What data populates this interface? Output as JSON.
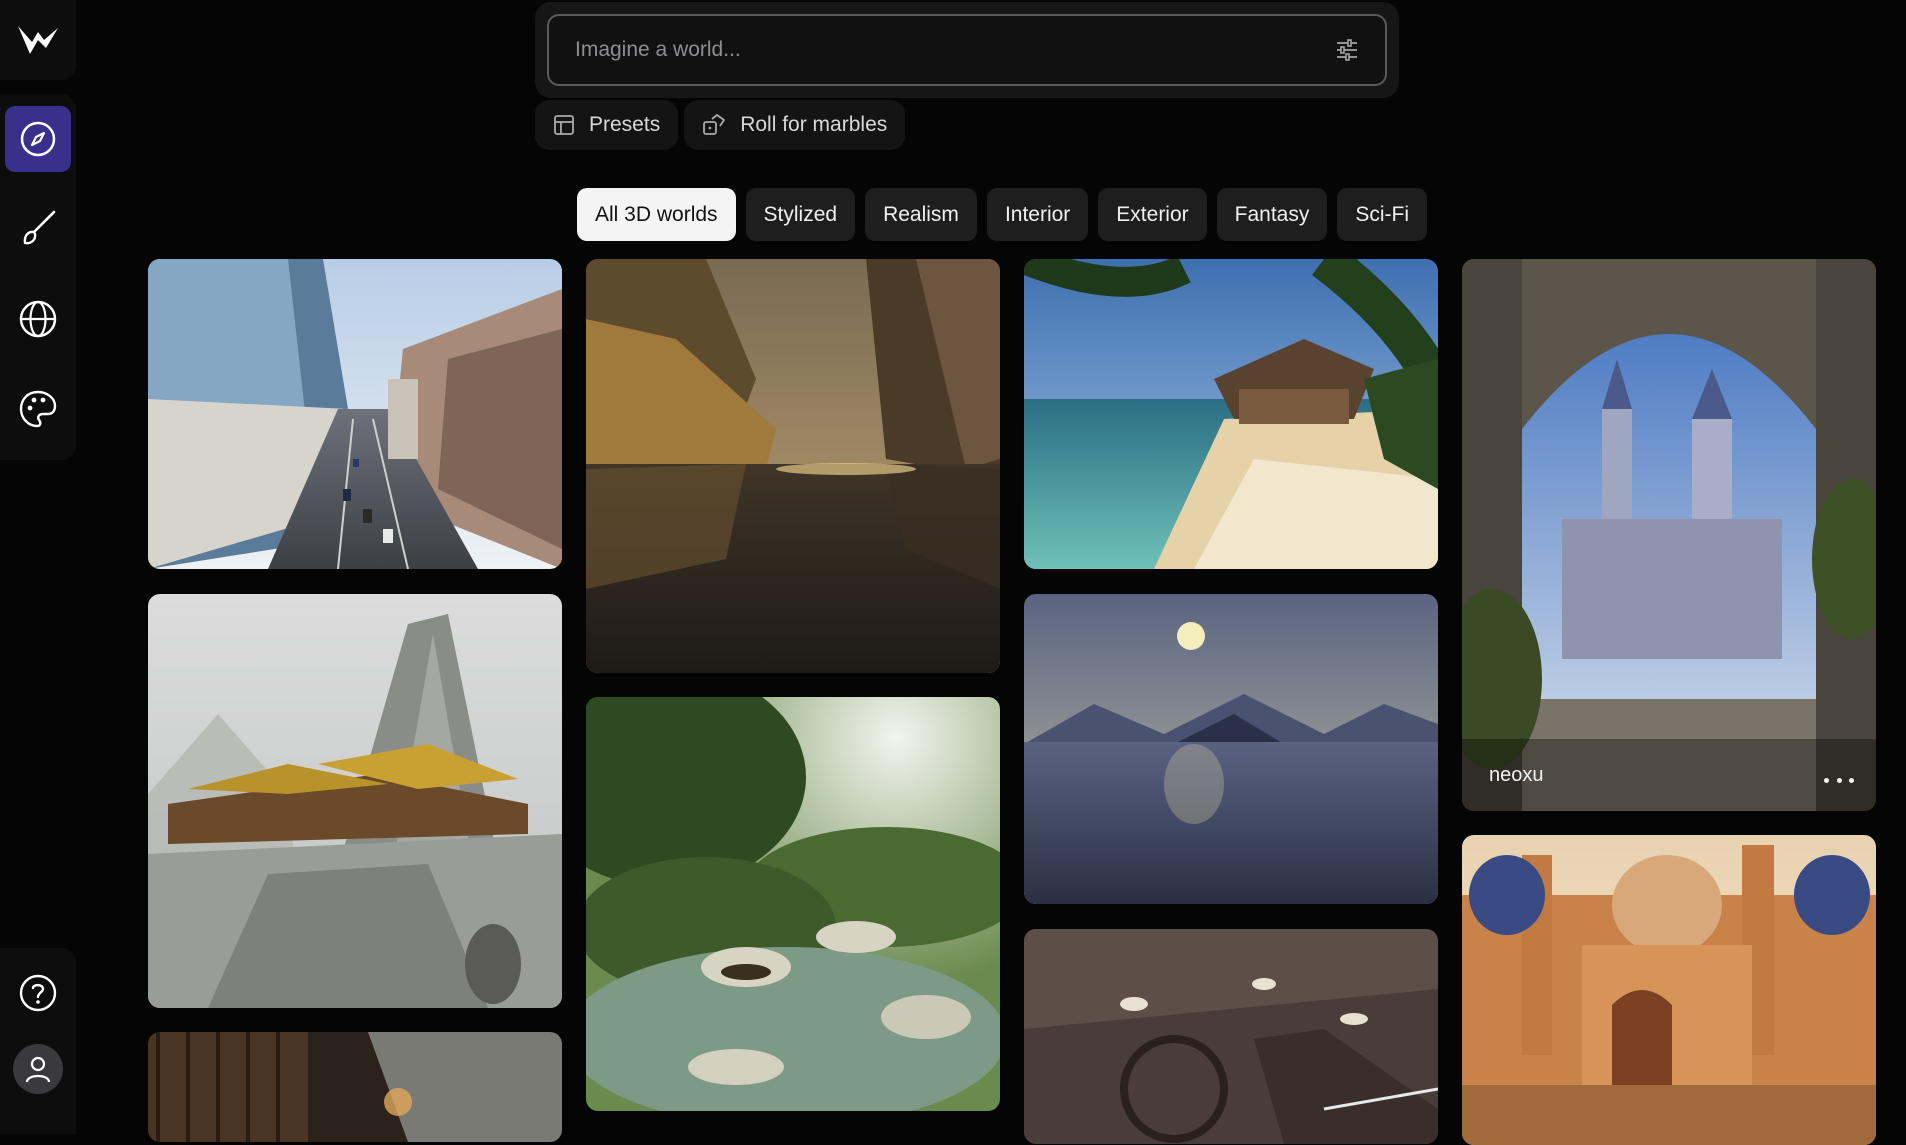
{
  "search": {
    "placeholder": "Imagine a world..."
  },
  "actions": {
    "presets_label": "Presets",
    "roll_label": "Roll for marbles"
  },
  "tabs": [
    "All 3D worlds",
    "Stylized",
    "Realism",
    "Interior",
    "Exterior",
    "Fantasy",
    "Sci-Fi"
  ],
  "featured_card": {
    "author": "neoxu"
  },
  "colors": {
    "accent": "#3a2f8a",
    "background": "#050505"
  },
  "icons": {
    "logo": "logo-icon",
    "explore": "compass-icon",
    "create": "brush-icon",
    "worlds": "globe-icon",
    "styles": "palette-icon",
    "help": "help-icon",
    "account": "user-icon"
  }
}
